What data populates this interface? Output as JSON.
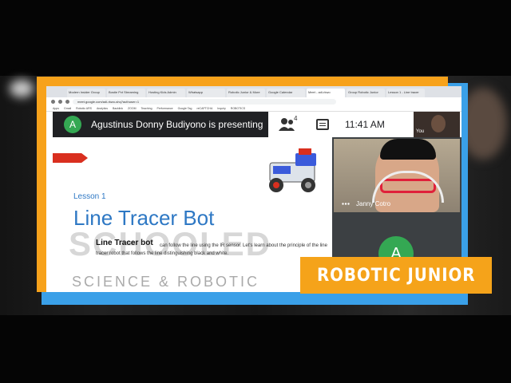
{
  "browser": {
    "tabs": [
      "Modern Insider Group",
      "Bostie Pvt Streaming",
      "Hosting Kids Admin",
      "Whatsapp",
      "Robotic Junior & More",
      "Google Calendar",
      "Meet - adi-rkwo",
      "Group Robotic Junior",
      "Lesson 1 - Line tracer"
    ],
    "url": "meet.google.com/adi-rkwo-shq?authuser=1",
    "bookmarks": [
      "Apps",
      "Gmail",
      "Robotic ARS",
      "Analytics",
      "Backlink",
      "ZOOM",
      "Teaching",
      "Performance",
      "Google Tag",
      "reCAPTCHA",
      "Inquiry",
      "ROBOTICS"
    ]
  },
  "meet": {
    "presenter_initial": "A",
    "presenting_text": "Agustinus Donny Budiyono is presenting",
    "participants_count": "4",
    "clock": "11:41 AM",
    "self_label": "You",
    "participant_name": "Janny Cotro",
    "second_tile_initial": "A"
  },
  "slide": {
    "lesson": "Lesson 1",
    "title": "Line Tracer Bot",
    "watermark": "SCHOOLED",
    "bold_intro": "Line Tracer bot",
    "body": "can follow the line using the IR sensor. Let's learn about the principle of the line tracer robot that follows the line distinguishing black and white.",
    "footer": "SCIENCE & ROBOTIC"
  },
  "banner": {
    "text": "ROBOTIC JUNIOR"
  },
  "colors": {
    "orange": "#f7a21b",
    "blue": "#3aa0e8",
    "meet_dark": "#202124",
    "meet_green": "#34a853",
    "slide_blue": "#2e78c4",
    "slide_red": "#d92f1f"
  }
}
